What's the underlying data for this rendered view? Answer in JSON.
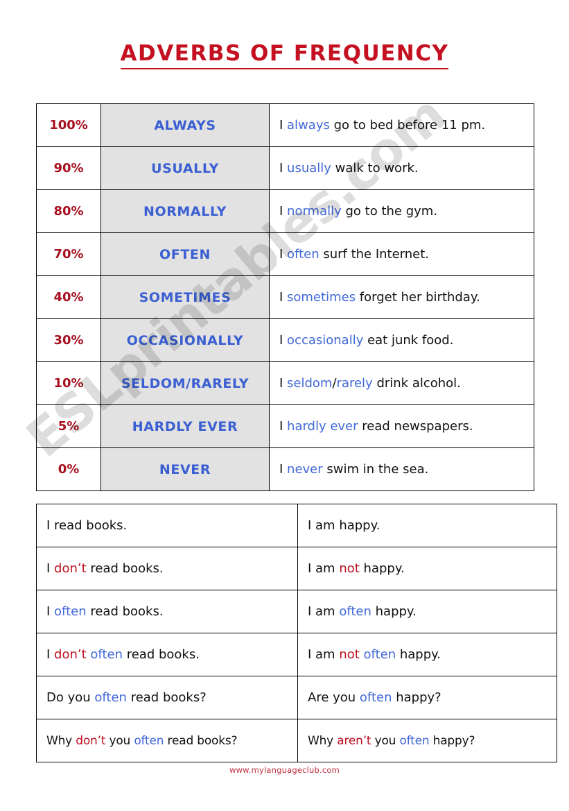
{
  "title": "ADVERBS OF FREQUENCY",
  "watermark": "ESLprintables.com",
  "colors": {
    "title_red": "#C41020",
    "percent_red": "#A8101F",
    "adverb_blue": "#3A5FD2",
    "inline_blue": "#4169D8",
    "inline_red": "#BD1020",
    "adverb_cell_bg": "#E2E2E2",
    "text_black": "#111111"
  },
  "frequency_table": {
    "rows": [
      {
        "percent": "100%",
        "adverb": "ALWAYS",
        "sentence": {
          "pre": "I ",
          "adverb": "always",
          "post": " go to bed before 11 pm."
        }
      },
      {
        "percent": "90%",
        "adverb": "USUALLY",
        "sentence": {
          "pre": "I ",
          "adverb": "usually",
          "post": " walk to work."
        }
      },
      {
        "percent": "80%",
        "adverb": "NORMALLY",
        "sentence": {
          "pre": "I ",
          "adverb": "normally",
          "post": " go to the gym."
        }
      },
      {
        "percent": "70%",
        "adverb": "OFTEN",
        "sentence": {
          "pre": "I ",
          "adverb": "often",
          "post": " surf the Internet."
        }
      },
      {
        "percent": "40%",
        "adverb": "SOMETIMES",
        "sentence": {
          "pre": "I ",
          "adverb": "sometimes",
          "post": " forget her birthday."
        }
      },
      {
        "percent": "30%",
        "adverb": "OCCASIONALLY",
        "sentence": {
          "pre": "I ",
          "adverb": "occasionally",
          "post": " eat junk food."
        }
      },
      {
        "percent": "10%",
        "adverb": "SELDOM/RARELY",
        "sentence": {
          "pre": "I ",
          "adverb": "seldom",
          "mid": "/",
          "adverb2": "rarely",
          "post": " drink alcohol."
        }
      },
      {
        "percent": "5%",
        "adverb": "HARDLY EVER",
        "sentence": {
          "pre": "I ",
          "adverb": "hardly ever",
          "post": " read newspapers."
        }
      },
      {
        "percent": "0%",
        "adverb": "NEVER",
        "sentence": {
          "pre": "I ",
          "adverb": "never",
          "post": " swim in the sea."
        }
      }
    ]
  },
  "forms_table": {
    "rows": [
      {
        "left": {
          "p1": "I read books.",
          "neg": "",
          "p2": "",
          "adv": "",
          "p3": ""
        },
        "right": {
          "p1": "I am happy.",
          "neg": "",
          "p2": "",
          "adv": "",
          "p3": ""
        }
      },
      {
        "left": {
          "p1": "I ",
          "neg": "don’t",
          "p2": " read books.",
          "adv": "",
          "p3": ""
        },
        "right": {
          "p1": "I am ",
          "neg": "not",
          "p2": " happy.",
          "adv": "",
          "p3": ""
        }
      },
      {
        "left": {
          "p1": "I ",
          "neg": "",
          "p2": "",
          "adv": "often",
          "p3": " read books."
        },
        "right": {
          "p1": "I am ",
          "neg": "",
          "p2": "",
          "adv": "often",
          "p3": " happy."
        }
      },
      {
        "left": {
          "p1": "I ",
          "neg": "don’t",
          "p2": " ",
          "adv": "often",
          "p3": " read books."
        },
        "right": {
          "p1": "I am ",
          "neg": "not",
          "p2": " ",
          "adv": "often",
          "p3": " happy."
        }
      },
      {
        "left": {
          "p1": "Do you ",
          "neg": "",
          "p2": "",
          "adv": "often",
          "p3": " read books?"
        },
        "right": {
          "p1": "Are you ",
          "neg": "",
          "p2": "",
          "adv": "often",
          "p3": " happy?"
        }
      },
      {
        "left": {
          "p1": "Why ",
          "neg": "don’t",
          "p2": " you ",
          "adv": "often",
          "p3": " read books?"
        },
        "right": {
          "p1": "Why ",
          "neg": "aren’t",
          "p2": " you ",
          "adv": "often",
          "p3": " happy?"
        }
      }
    ]
  },
  "footer": {
    "url": "www.mylanguageclub.com"
  }
}
